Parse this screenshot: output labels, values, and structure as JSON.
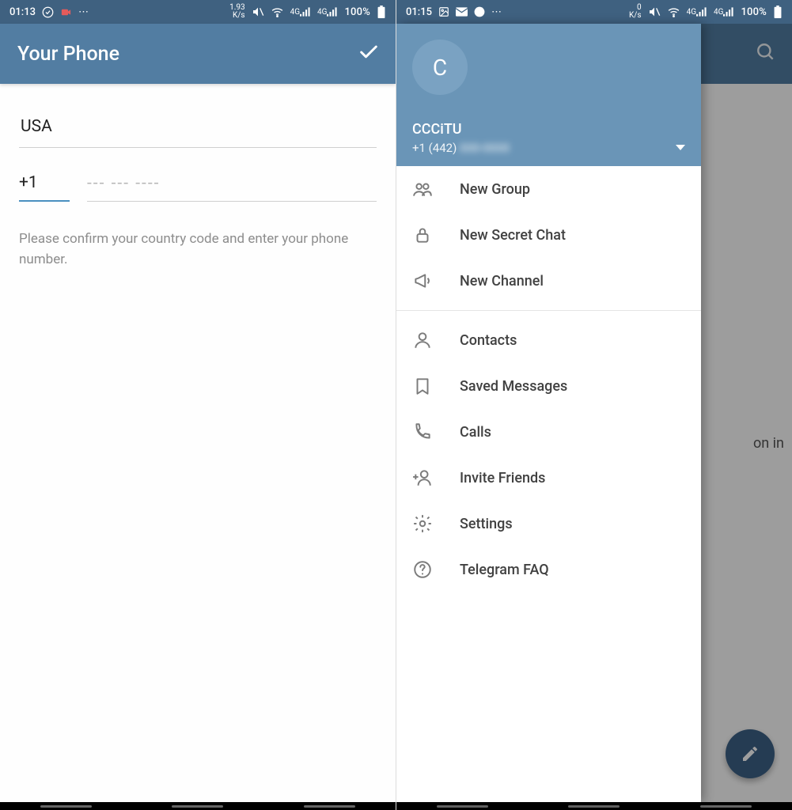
{
  "screen1": {
    "status": {
      "time": "01:13",
      "net_speed": "1.93",
      "net_unit": "K/s",
      "battery": "100%"
    },
    "appbar": {
      "title": "Your Phone"
    },
    "form": {
      "country": "USA",
      "country_code": "+1",
      "phone_placeholder": "--- --- ----",
      "hint": "Please confirm your country code and enter your phone number."
    }
  },
  "screen2": {
    "status": {
      "time": "01:15",
      "net_speed": "0",
      "net_unit": "K/s",
      "battery": "100%"
    },
    "drawer": {
      "avatar_letter": "C",
      "account_name": "CCCiTU",
      "account_phone_visible": "+1 (442)",
      "account_phone_hidden": "000-0000",
      "items_a": [
        {
          "key": "new-group",
          "label": "New Group",
          "icon": "group"
        },
        {
          "key": "new-secret-chat",
          "label": "New Secret Chat",
          "icon": "lock"
        },
        {
          "key": "new-channel",
          "label": "New Channel",
          "icon": "megaphone"
        }
      ],
      "items_b": [
        {
          "key": "contacts",
          "label": "Contacts",
          "icon": "person"
        },
        {
          "key": "saved-messages",
          "label": "Saved Messages",
          "icon": "bookmark"
        },
        {
          "key": "calls",
          "label": "Calls",
          "icon": "phone"
        },
        {
          "key": "invite-friends",
          "label": "Invite Friends",
          "icon": "add-person"
        },
        {
          "key": "settings",
          "label": "Settings",
          "icon": "gear"
        },
        {
          "key": "telegram-faq",
          "label": "Telegram FAQ",
          "icon": "help"
        }
      ]
    },
    "background_text_fragment": "on in"
  }
}
